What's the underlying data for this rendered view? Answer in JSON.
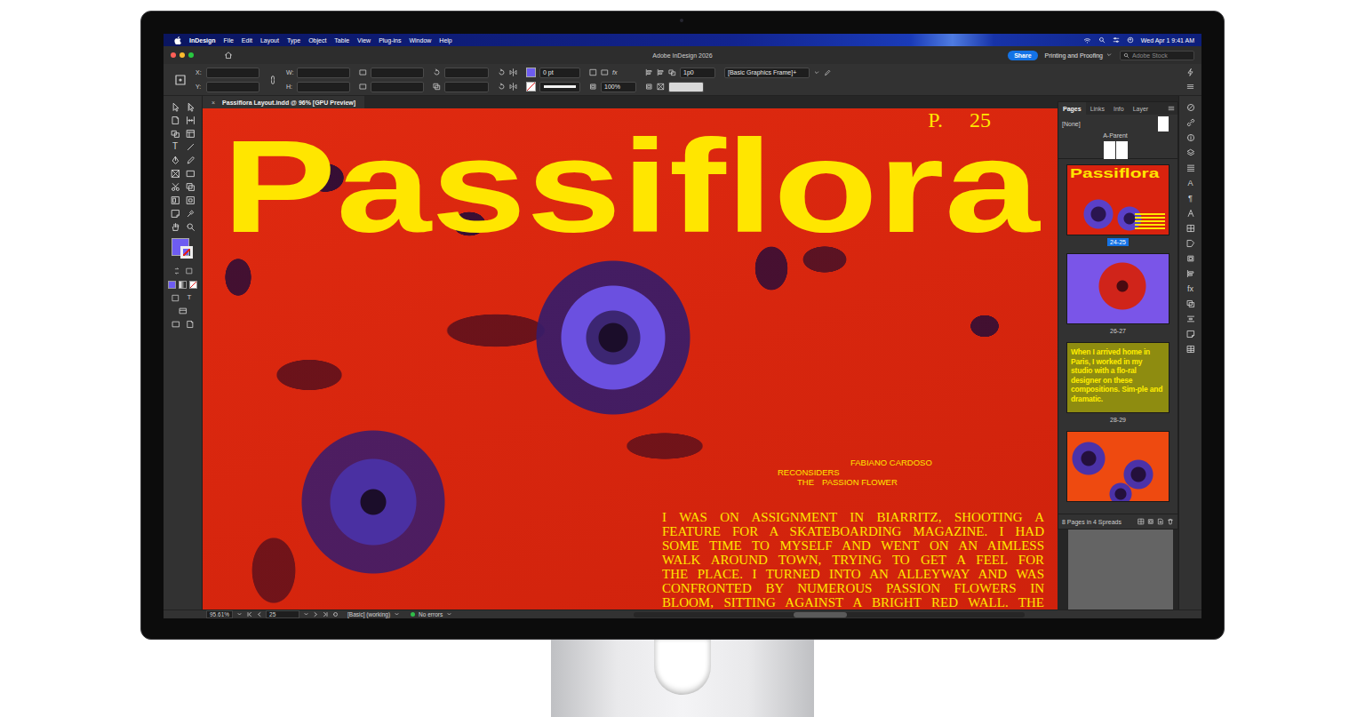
{
  "menu_bar": {
    "app": "InDesign",
    "items": [
      "File",
      "Edit",
      "Layout",
      "Type",
      "Object",
      "Table",
      "View",
      "Plug-ins",
      "Window",
      "Help"
    ],
    "clock": "Wed Apr 1 9:41 AM"
  },
  "window": {
    "title": "Adobe InDesign 2026"
  },
  "header": {
    "share": "Share",
    "workspace": "Printing and Proofing",
    "search": {
      "placeholder": "Adobe Stock"
    }
  },
  "control_panel": {
    "position_fields": [
      {
        "label": "X:"
      },
      {
        "label": "Y:"
      }
    ],
    "size_fields": [
      {
        "label": "W:"
      },
      {
        "label": "H:"
      }
    ],
    "stroke_weight": "0 pt",
    "scale": "100%",
    "fx": "fx",
    "gap": "1p0",
    "object_style": "[Basic Graphics Frame]+"
  },
  "toolbar": {
    "type_glyph": "T",
    "mode_glyph": "T"
  },
  "document": {
    "close": "×",
    "tab": "Passiflora Layout.indd @ 96% [GPU Preview]",
    "folio_label": "P.",
    "folio_number": "25",
    "title": "Passiflora",
    "byline": [
      [
        "FABIANO CARDOSO"
      ],
      [
        "RECONSIDERS"
      ],
      [
        "THE",
        "PASSION FLOWER"
      ]
    ],
    "body": [
      "I WAS ON ASSIGNMENT IN BIARRITZ, SHOOTING A",
      "FEATURE FOR A SKATEBOARDING MAGAZINE. I HAD",
      "SOME TIME TO MYSELF AND WENT ON AN AIMLESS",
      "WALK AROUND TOWN, TRYING TO GET A FEEL FOR",
      "THE PLACE. I TURNED INTO AN ALLEYWAY AND WAS",
      "CONFRONTED BY NUMEROUS PASSION FLOWERS IN",
      "BLOOM, SITTING AGAINST A BRIGHT RED WALL. THE"
    ]
  },
  "pages_panel": {
    "tabs": [
      {
        "label": "Pages",
        "selected": true
      },
      {
        "label": "Links",
        "selected": false
      },
      {
        "label": "Info",
        "selected": false
      },
      {
        "label": "Layer",
        "selected": false
      }
    ],
    "masters": [
      {
        "label": "[None]",
        "kind": "single"
      },
      {
        "label": "A-Parent",
        "kind": "spread"
      }
    ],
    "spreads": [
      {
        "label": "24-25",
        "selected": true,
        "kind": "title",
        "color": "#d9230e",
        "title": "Passiflora"
      },
      {
        "label": "26-27",
        "selected": false,
        "kind": "photo",
        "color": "#7a55e8"
      },
      {
        "label": "28-29",
        "selected": false,
        "kind": "text",
        "color": "#8e8c10",
        "text": "When I arrived home in Paris, I worked in my studio with a flo-ral designer on these compositions. Sim-ple and dramatic."
      },
      {
        "selected": false,
        "kind": "photo",
        "color": "#ee4a10"
      }
    ],
    "footer": "8 Pages in 4 Spreads"
  },
  "right_rail": {
    "glyphs": [
      "A",
      "¶",
      "fx"
    ]
  },
  "status_bar": {
    "zoom": "95.61%",
    "page": "25",
    "preflight_profile": "[Basic] (working)",
    "preflight": "No errors",
    "ok": true
  }
}
